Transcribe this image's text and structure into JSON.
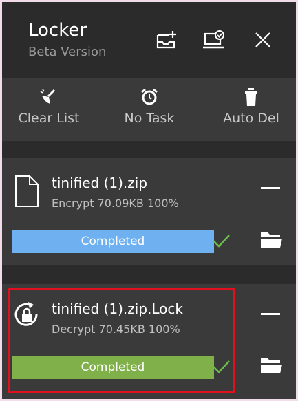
{
  "header": {
    "title": "Locker",
    "subtitle": "Beta Version",
    "icons": [
      "add-tray-icon",
      "laptop-check-icon",
      "close-icon"
    ]
  },
  "toolbar": {
    "items": [
      {
        "label": "Clear List",
        "icon": "broom-icon"
      },
      {
        "label": "No Task",
        "icon": "alarm-clock-icon"
      },
      {
        "label": "Auto Del",
        "icon": "trash-icon"
      }
    ]
  },
  "files": [
    {
      "name": "tinified (1).zip",
      "meta": "Encrypt 70.09KB 100%",
      "status": "Completed",
      "progress": 1.0,
      "bar_color": "#6fb1f0",
      "icon": "document-icon"
    },
    {
      "name": "tinified (1).zip.Lock",
      "meta": "Decrypt 70.45KB 100%",
      "status": "Completed",
      "progress": 1.0,
      "bar_color": "#7fb04a",
      "icon": "lock-refresh-icon"
    }
  ],
  "colors": {
    "check": "#6cbf4a",
    "highlight": "#e0101f"
  }
}
